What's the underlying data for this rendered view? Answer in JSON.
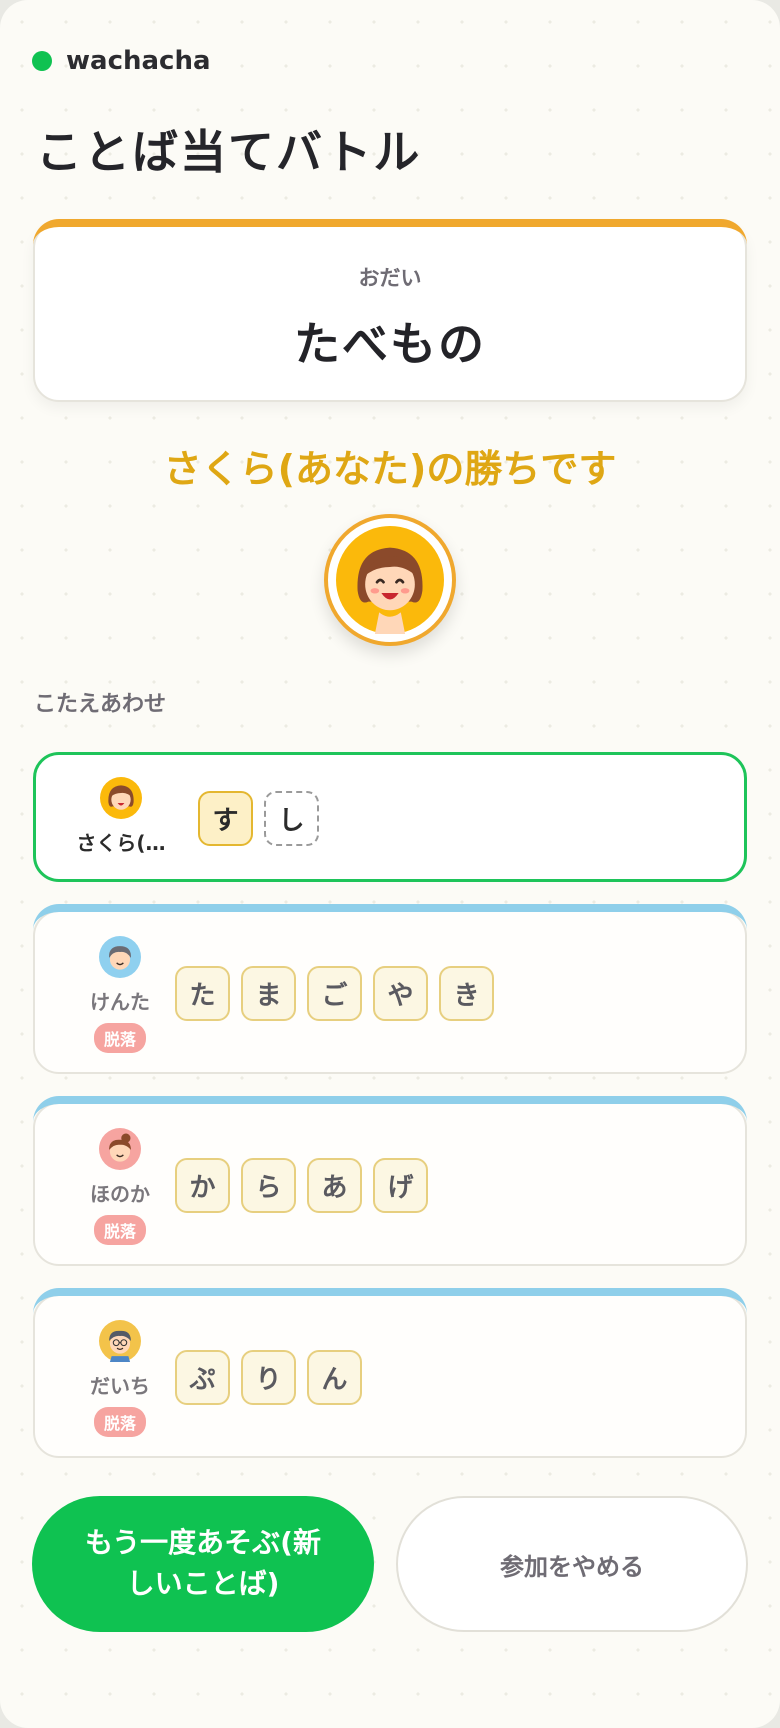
{
  "brand": {
    "name": "wachacha",
    "dot_color": "#0fc251"
  },
  "title": "ことば当てバトル",
  "topic": {
    "label": "おだい",
    "value": "たべもの",
    "accent": "#f0a82e"
  },
  "winner_message": "さくら(あなた)の勝ちです",
  "section_label": "こたえあわせ",
  "players": [
    {
      "name": "さくら(…",
      "status": "winner",
      "tiles": [
        "す",
        "し"
      ],
      "empty_last": true
    },
    {
      "name": "けんた",
      "status": "out",
      "badge": "脱落",
      "tiles": [
        "た",
        "ま",
        "ご",
        "や",
        "き"
      ]
    },
    {
      "name": "ほのか",
      "status": "out",
      "badge": "脱落",
      "tiles": [
        "か",
        "ら",
        "あ",
        "げ"
      ]
    },
    {
      "name": "だいち",
      "status": "out",
      "badge": "脱落",
      "tiles": [
        "ぷ",
        "り",
        "ん"
      ]
    }
  ],
  "actions": {
    "play_again": "もう一度あそぶ(新しいことば)",
    "leave": "参加をやめる"
  },
  "colors": {
    "primary": "#0fc251",
    "winner_text": "#dfa714",
    "out_band": "#8fcfea",
    "badge": "#f6a4a0"
  },
  "icons": [
    "avatar-girl-icon",
    "avatar-boy-icon",
    "avatar-girl-bun-icon",
    "avatar-boy-glasses-icon"
  ]
}
